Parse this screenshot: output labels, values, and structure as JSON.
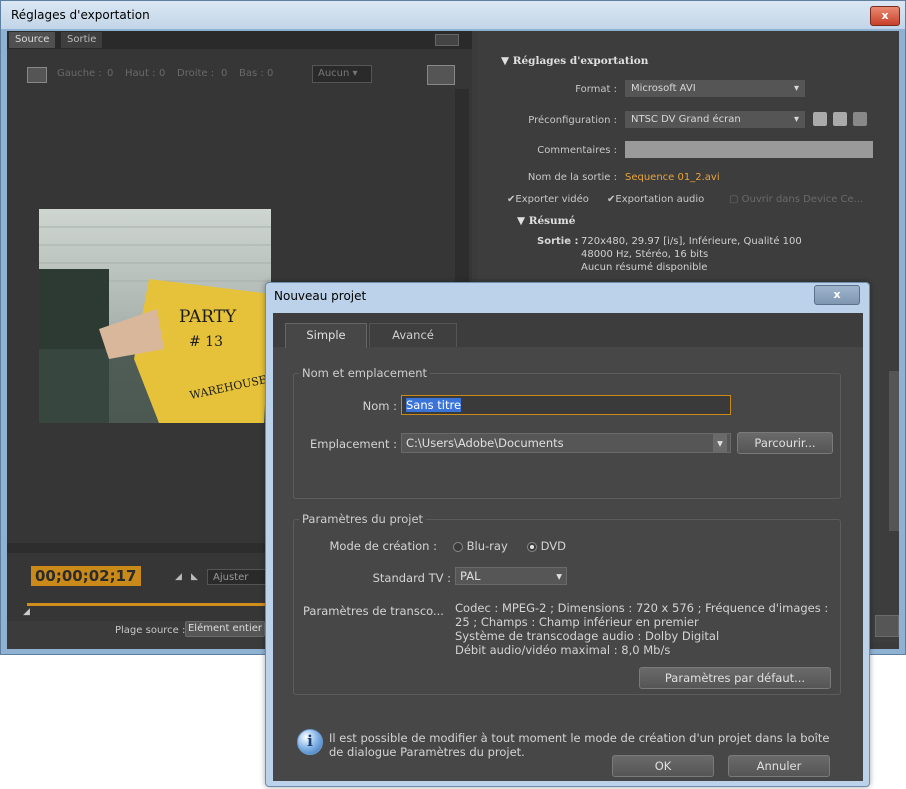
{
  "export_window": {
    "title": "Réglages d'exportation",
    "close_label": "x",
    "tabs": [
      "Source",
      "Sortie"
    ],
    "crop_fields": [
      {
        "label": "Gauche :",
        "value": "0"
      },
      {
        "label": "Haut :",
        "value": "0"
      },
      {
        "label": "Droite :",
        "value": "0"
      },
      {
        "label": "Bas :",
        "value": "0"
      }
    ],
    "crop_preset": "Aucun",
    "timecode": "00;00;02;17",
    "fit_label": "Ajuster",
    "range_label": "Plage source :",
    "range_value": "Elément entier",
    "video_frame_text": {
      "line1": "PARTY",
      "line2": "# 13",
      "line3": "WAREHOUSE"
    },
    "settings": {
      "section_title": "Réglages d'exportation",
      "format_label": "Format :",
      "format_value": "Microsoft AVI",
      "preset_label": "Préconfiguration :",
      "preset_value": "NTSC DV Grand écran",
      "comments_label": "Commentaires :",
      "output_name_label": "Nom de la sortie :",
      "output_name_value": "Sequence 01_2.avi",
      "export_video_label": "Exporter vidéo",
      "export_audio_label": "Exportation audio",
      "open_device_label": "Ouvrir dans Device Ce...",
      "summary_title": "Résumé",
      "output_label": "Sortie :",
      "output_line1": "720x480, 29.97 [i/s], Inférieure, Qualité 100",
      "output_line2": "48000 Hz, Stéréo, 16 bits",
      "output_line3": "Aucun résumé disponible"
    }
  },
  "dialog": {
    "title": "Nouveau projet",
    "close_label": "x",
    "tabs": [
      "Simple",
      "Avancé"
    ],
    "name_location": {
      "group_title": "Nom et emplacement",
      "name_label": "Nom :",
      "name_value": "Sans titre",
      "location_label": "Emplacement :",
      "location_value": "C:\\Users\\Adobe\\Documents",
      "browse_label": "Parcourir..."
    },
    "project_params": {
      "group_title": "Paramètres du projet",
      "mode_label": "Mode de création :",
      "mode_options": [
        "Blu-ray",
        "DVD"
      ],
      "mode_selected": "DVD",
      "tv_label": "Standard TV :",
      "tv_value": "PAL",
      "transcode_label": "Paramètres de transco...",
      "transcode_line1": "Codec : MPEG-2 ; Dimensions : 720 x 576 ; Fréquence d'images :",
      "transcode_line2": "25 ; Champs : Champ inférieur en premier",
      "transcode_line3": "Système de transcodage audio : Dolby Digital",
      "transcode_line4": "Débit audio/vidéo maximal : 8,0 Mb/s",
      "defaults_label": "Paramètres par défaut..."
    },
    "info_line1": "Il est possible de modifier à tout moment le mode de création d'un projet dans la boîte",
    "info_line2": "de dialogue Paramètres du projet.",
    "ok_label": "OK",
    "cancel_label": "Annuler"
  },
  "colors": {
    "timecode": "#f0a020",
    "link_orange": "#e8a33a",
    "highlight_blue": "#3a74d8"
  }
}
